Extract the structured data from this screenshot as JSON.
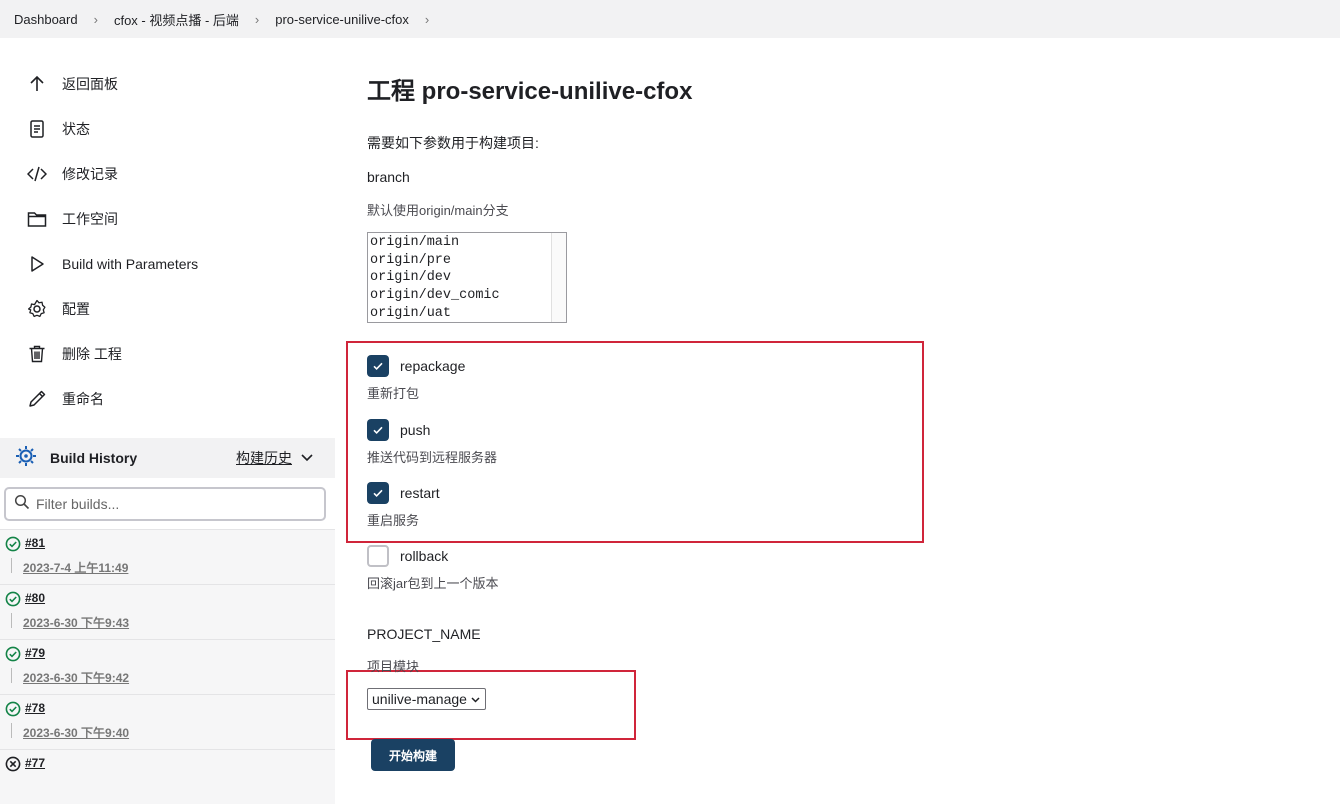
{
  "breadcrumb": [
    "Dashboard",
    "cfox - 视频点播 - 后端",
    "pro-service-unilive-cfox"
  ],
  "sidebar": {
    "tasks": [
      {
        "label": "返回面板",
        "icon": "arrow-up-icon"
      },
      {
        "label": "状态",
        "icon": "document-icon"
      },
      {
        "label": "修改记录",
        "icon": "code-icon"
      },
      {
        "label": "工作空间",
        "icon": "folder-icon"
      },
      {
        "label": "Build with Parameters",
        "icon": "play-icon"
      },
      {
        "label": "配置",
        "icon": "gear-icon"
      },
      {
        "label": "删除 工程",
        "icon": "trash-icon"
      },
      {
        "label": "重命名",
        "icon": "pencil-icon"
      }
    ],
    "build_history": {
      "title": "Build History",
      "trend": "构建历史",
      "filter_placeholder": "Filter builds...",
      "builds": [
        {
          "num": "#81",
          "date": "2023-7-4 上午11:49",
          "status": "success"
        },
        {
          "num": "#80",
          "date": "2023-6-30 下午9:43",
          "status": "success"
        },
        {
          "num": "#79",
          "date": "2023-6-30 下午9:42",
          "status": "success"
        },
        {
          "num": "#78",
          "date": "2023-6-30 下午9:40",
          "status": "success"
        },
        {
          "num": "#77",
          "date": "",
          "status": "aborted"
        }
      ]
    }
  },
  "main": {
    "title": "工程 pro-service-unilive-cfox",
    "intro": "需要如下参数用于构建项目:",
    "branch": {
      "name": "branch",
      "desc": "默认使用origin/main分支",
      "options": [
        "origin/main",
        "origin/pre",
        "origin/dev",
        "origin/dev_comic",
        "origin/uat"
      ]
    },
    "checkboxes": [
      {
        "name": "repackage",
        "desc": "重新打包",
        "checked": true
      },
      {
        "name": "push",
        "desc": "推送代码到远程服务器",
        "checked": true
      },
      {
        "name": "restart",
        "desc": "重启服务",
        "checked": true
      },
      {
        "name": "rollback",
        "desc": "回滚jar包到上一个版本",
        "checked": false
      }
    ],
    "project": {
      "name": "PROJECT_NAME",
      "desc": "项目模块",
      "selected": "unilive-manage"
    },
    "submit": "开始构建"
  },
  "colors": {
    "accent": "#1a4163",
    "highlight": "#d0253a",
    "success": "#138347"
  }
}
